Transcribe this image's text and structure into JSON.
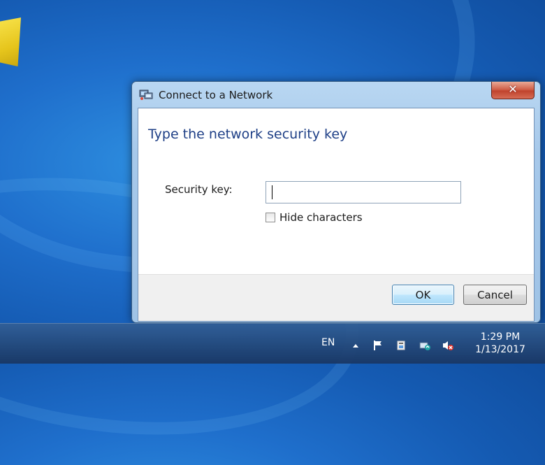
{
  "dialog": {
    "title": "Connect to a Network",
    "close_label": "✕",
    "heading": "Type the network security key",
    "security_key_label": "Security key:",
    "security_key_value": "",
    "hide_characters_label": "Hide characters",
    "hide_characters_checked": false,
    "ok_label": "OK",
    "cancel_label": "Cancel"
  },
  "taskbar": {
    "language": "EN",
    "time": "1:29 PM",
    "date": "1/13/2017"
  },
  "icons": [
    "network-icon",
    "close-icon",
    "show-hidden-icons-icon",
    "action-center-flag-icon",
    "power-icon",
    "network-status-icon",
    "volume-muted-icon"
  ],
  "colors": {
    "heading": "#1e3f86",
    "close_button": "#c0432d",
    "desktop": "#1f6fcc"
  }
}
